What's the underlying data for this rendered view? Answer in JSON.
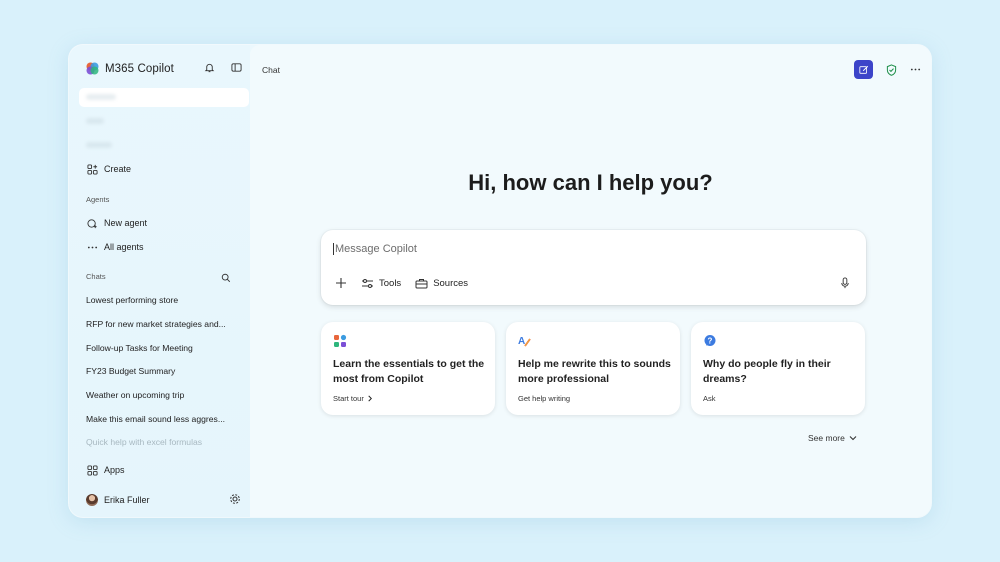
{
  "app": {
    "brand": "M365 Copilot",
    "page_title": "Chat",
    "accent": "#3c44c9"
  },
  "sidebar": {
    "create_label": "Create",
    "agents_section": "Agents",
    "new_agent": "New agent",
    "all_agents": "All agents",
    "chats_section": "Chats",
    "chats": [
      "Lowest performing store",
      "RFP for new market strategies and...",
      "Follow-up Tasks for Meeting",
      "FY23 Budget Summary",
      "Weather on upcoming trip",
      "Make this email sound less aggres...",
      "Quick help with excel formulas"
    ],
    "apps_label": "Apps",
    "user_name": "Erika Fuller"
  },
  "main": {
    "greeting": "Hi, how can I help you?",
    "composer": {
      "placeholder": "Message Copilot",
      "tools_label": "Tools",
      "sources_label": "Sources"
    },
    "cards": [
      {
        "title": "Learn the essentials to get the most from Copilot",
        "sub": "Start tour",
        "icon": "apps-grid-icon"
      },
      {
        "title": "Help me rewrite this to sounds more professional",
        "sub": "Get help writing",
        "icon": "text-edit-icon"
      },
      {
        "title": "Why do people fly in their dreams?",
        "sub": "Ask",
        "icon": "question-bubble-icon"
      }
    ],
    "see_more": "See more"
  }
}
